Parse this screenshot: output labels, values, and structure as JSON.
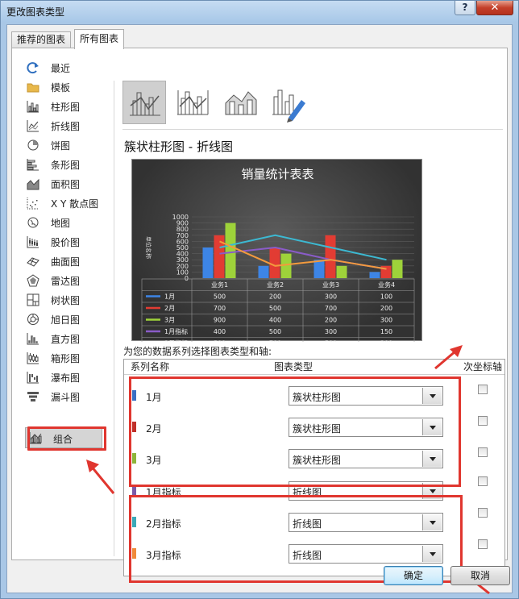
{
  "window": {
    "title": "更改图表类型",
    "help_label": "?",
    "close_label": "✕"
  },
  "tabs": [
    {
      "label": "推荐的图表",
      "active": false
    },
    {
      "label": "所有图表",
      "active": true
    }
  ],
  "sidebar": {
    "items": [
      {
        "label": "最近",
        "icon": "recent-icon"
      },
      {
        "label": "模板",
        "icon": "folder-icon"
      },
      {
        "label": "柱形图",
        "icon": "column-chart-icon"
      },
      {
        "label": "折线图",
        "icon": "line-chart-icon"
      },
      {
        "label": "饼图",
        "icon": "pie-chart-icon"
      },
      {
        "label": "条形图",
        "icon": "bar-chart-icon"
      },
      {
        "label": "面积图",
        "icon": "area-chart-icon"
      },
      {
        "label": "X Y 散点图",
        "icon": "scatter-chart-icon"
      },
      {
        "label": "地图",
        "icon": "map-chart-icon"
      },
      {
        "label": "股价图",
        "icon": "stock-chart-icon"
      },
      {
        "label": "曲面图",
        "icon": "surface-chart-icon"
      },
      {
        "label": "雷达图",
        "icon": "radar-chart-icon"
      },
      {
        "label": "树状图",
        "icon": "treemap-chart-icon"
      },
      {
        "label": "旭日图",
        "icon": "sunburst-chart-icon"
      },
      {
        "label": "直方图",
        "icon": "histogram-chart-icon"
      },
      {
        "label": "箱形图",
        "icon": "box-whisker-chart-icon"
      },
      {
        "label": "瀑布图",
        "icon": "waterfall-chart-icon"
      },
      {
        "label": "漏斗图",
        "icon": "funnel-chart-icon"
      },
      {
        "label": "组合",
        "icon": "combo-chart-icon",
        "selected": true
      }
    ]
  },
  "combo": {
    "title": "簇状柱形图 - 折线图",
    "subtypes": [
      "clustered-column-line",
      "clustered-column-line-secondary",
      "stacked-area-clustered-column",
      "custom-combination"
    ],
    "selected_subtype": 0
  },
  "preview": {
    "title": "销量统计表表",
    "ylabel": "单位名称",
    "y_ticks": [
      "1000",
      "900",
      "800",
      "700",
      "600",
      "500",
      "400",
      "300",
      "200",
      "100",
      "0"
    ],
    "categories": [
      "业务1",
      "业务2",
      "业务3",
      "业务4"
    ],
    "series": [
      {
        "name": "1月",
        "kind": "bar",
        "color": "#3d85e6",
        "values": [
          500,
          200,
          300,
          100
        ]
      },
      {
        "name": "2月",
        "kind": "bar",
        "color": "#e23c33",
        "values": [
          700,
          500,
          700,
          200
        ]
      },
      {
        "name": "3月",
        "kind": "bar",
        "color": "#9ed23a",
        "values": [
          900,
          400,
          200,
          300
        ]
      },
      {
        "name": "1月指标",
        "kind": "line",
        "color": "#8a5cc8",
        "values": [
          400,
          500,
          300,
          150
        ]
      },
      {
        "name": "2月指标",
        "kind": "line",
        "color": "#3cb9d2",
        "values": [
          500,
          700,
          500,
          300
        ]
      },
      {
        "name": "3月指标",
        "kind": "line",
        "color": "#f39a3d",
        "values": [
          600,
          200,
          300,
          150
        ]
      }
    ]
  },
  "series_caption": "为您的数据系列选择图表类型和轴:",
  "series_table": {
    "headers": {
      "name": "系列名称",
      "type": "图表类型",
      "axis": "次坐标轴"
    },
    "rows": [
      {
        "name": "1月",
        "color": "#3a6fc4",
        "type": "簇状柱形图",
        "secondary": false
      },
      {
        "name": "2月",
        "color": "#c0302a",
        "type": "簇状柱形图",
        "secondary": false
      },
      {
        "name": "3月",
        "color": "#8db53a",
        "type": "簇状柱形图",
        "secondary": false
      },
      {
        "name": "1月指标",
        "color": "#7c5aa8",
        "type": "折线图",
        "secondary": false
      },
      {
        "name": "2月指标",
        "color": "#3aa9b8",
        "type": "折线图",
        "secondary": false
      },
      {
        "name": "3月指标",
        "color": "#f08a3a",
        "type": "折线图",
        "secondary": false
      }
    ]
  },
  "buttons": {
    "ok": "确定",
    "cancel": "取消"
  }
}
